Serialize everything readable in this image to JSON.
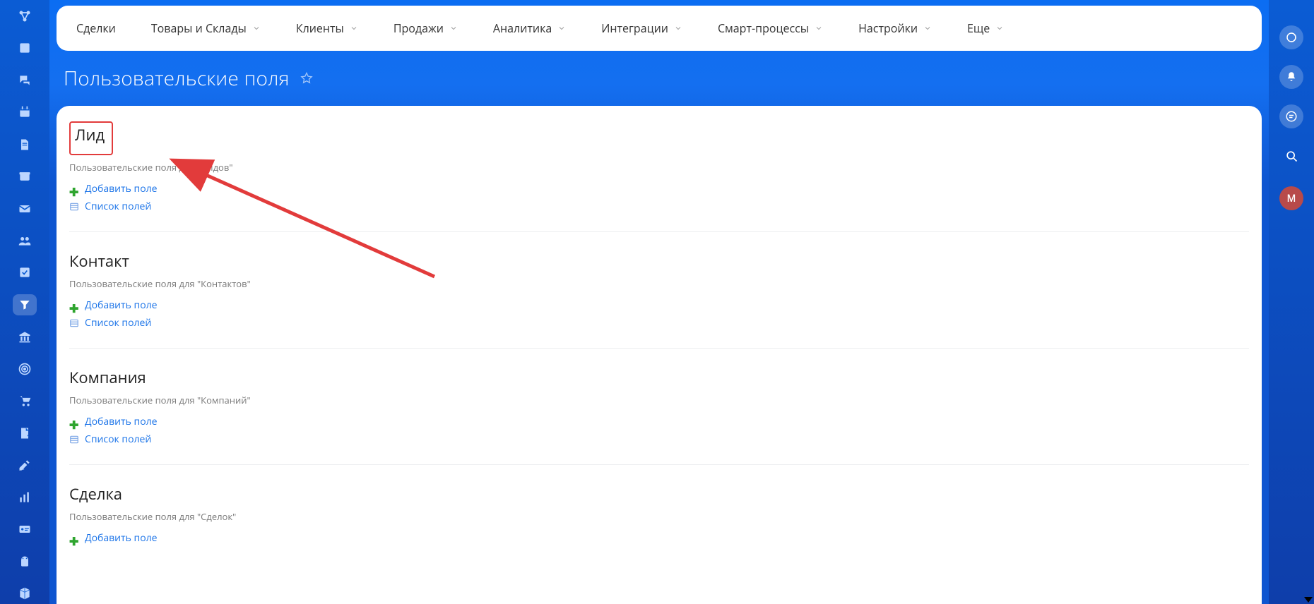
{
  "page_title": "Пользовательские поля",
  "nav": [
    {
      "label": "Сделки",
      "chevron": false
    },
    {
      "label": "Товары и Склады",
      "chevron": true
    },
    {
      "label": "Клиенты",
      "chevron": true
    },
    {
      "label": "Продажи",
      "chevron": true
    },
    {
      "label": "Аналитика",
      "chevron": true
    },
    {
      "label": "Интеграции",
      "chevron": true
    },
    {
      "label": "Смарт-процессы",
      "chevron": true
    },
    {
      "label": "Настройки",
      "chevron": true
    },
    {
      "label": "Еще",
      "chevron": true
    }
  ],
  "sections": [
    {
      "title": "Лид",
      "subtitle": "Пользовательские поля для \"Лидов\"",
      "add": "Добавить поле",
      "list": "Список полей",
      "highlight": true
    },
    {
      "title": "Контакт",
      "subtitle": "Пользовательские поля для \"Контактов\"",
      "add": "Добавить поле",
      "list": "Список полей",
      "highlight": false
    },
    {
      "title": "Компания",
      "subtitle": "Пользовательские поля для \"Компаний\"",
      "add": "Добавить поле",
      "list": "Список полей",
      "highlight": false
    },
    {
      "title": "Сделка",
      "subtitle": "Пользовательские поля для \"Сделок\"",
      "add": "Добавить поле",
      "list": null,
      "highlight": false
    }
  ],
  "left_rail_icons": [
    "network-icon",
    "feed-icon",
    "chat-icon",
    "calendar-icon",
    "doc-icon",
    "box-icon",
    "mail-icon",
    "people-icon",
    "check-icon",
    "filter-icon",
    "bank-icon",
    "target-icon",
    "cart-icon",
    "note-icon",
    "draw-icon",
    "bars-icon",
    "card-icon",
    "android-icon",
    "cube-icon"
  ],
  "right_rail": {
    "avatar_letter": "M"
  },
  "annotation": {
    "highlight_color": "#e23b3b"
  }
}
